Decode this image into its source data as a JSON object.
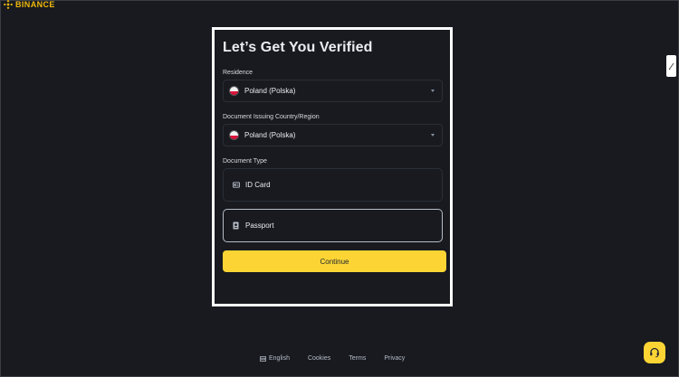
{
  "brand": {
    "name": "BINANCE",
    "accent": "#f0b90b"
  },
  "form": {
    "title": "Let’s Get You Verified",
    "residence_label": "Residence",
    "residence_value": "Poland (Polska)",
    "issuing_label": "Document Issuing Country/Region",
    "issuing_value": "Poland (Polska)",
    "doc_type_label": "Document Type",
    "doc_types": [
      {
        "label": "ID Card",
        "icon": "id-card-icon",
        "selected": false
      },
      {
        "label": "Passport",
        "icon": "passport-icon",
        "selected": true
      }
    ],
    "continue_label": "Continue"
  },
  "footer": {
    "language": "English",
    "links": [
      "Cookies",
      "Terms",
      "Privacy"
    ]
  },
  "colors": {
    "background": "#181a20",
    "button": "#fcd535",
    "border": "#2b2f36",
    "selected_border": "#b7bdc6"
  }
}
